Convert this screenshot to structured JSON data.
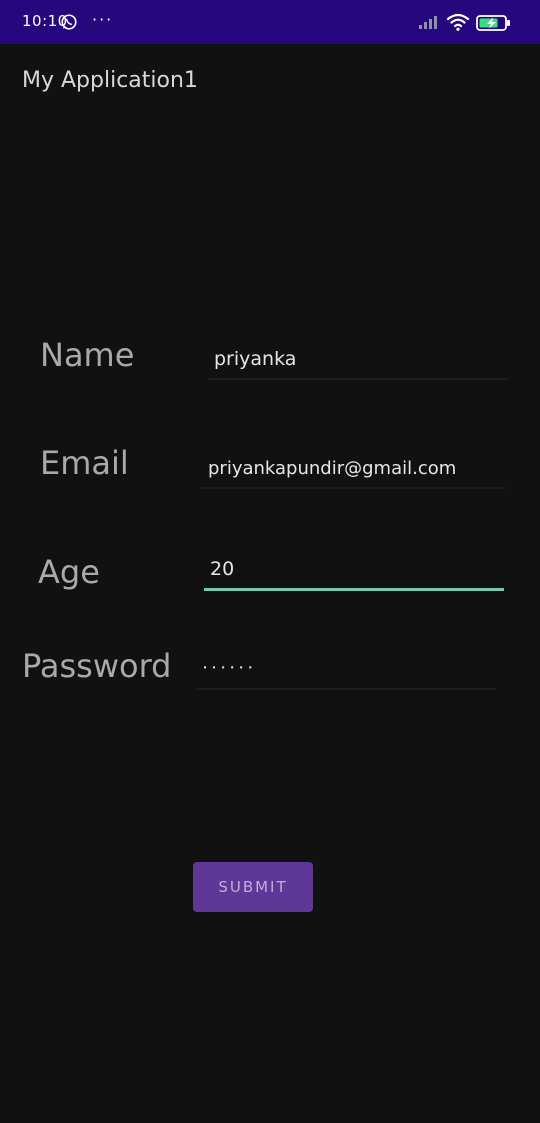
{
  "status_bar": {
    "time": "10:10",
    "icons": [
      "whatsapp-icon",
      "more-icon",
      "signal-icon",
      "wifi-icon",
      "battery-icon"
    ],
    "more_glyph": "···",
    "color": "#26077e"
  },
  "app_bar": {
    "title": "My Application1"
  },
  "form": {
    "name": {
      "label": "Name",
      "value": "priyanka"
    },
    "email": {
      "label": "Email",
      "value": "priyankapundir@gmail.com"
    },
    "age": {
      "label": "Age",
      "value": "20"
    },
    "password": {
      "label": "Password",
      "value": "······"
    }
  },
  "submit_label": "SUBMIT",
  "colors": {
    "background": "#111111",
    "accent": "#74c7b1",
    "button": "#5e3797"
  }
}
